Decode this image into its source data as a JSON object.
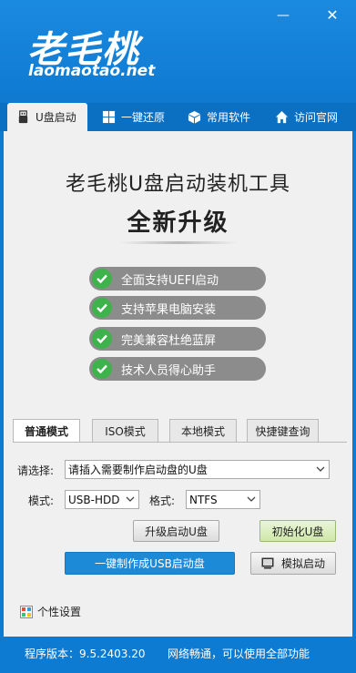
{
  "window": {
    "logo_cn": "老毛桃",
    "logo_en": "laomaotao.net",
    "minimize_glyph": "—",
    "close_glyph": "✕"
  },
  "nav": {
    "items": [
      {
        "label": "U盘启动",
        "icon": "usb-icon",
        "active": true
      },
      {
        "label": "一键还原",
        "icon": "windows-icon",
        "active": false
      },
      {
        "label": "常用软件",
        "icon": "box-icon",
        "active": false
      },
      {
        "label": "访问官网",
        "icon": "home-icon",
        "active": false
      }
    ]
  },
  "hero": {
    "title": "老毛桃U盘启动装机工具",
    "subtitle": "全新升级"
  },
  "features": [
    "全面支持UEFI启动",
    "支持苹果电脑安装",
    "完美兼容杜绝蓝屏",
    "技术人员得心助手"
  ],
  "mode_tabs": [
    "普通模式",
    "ISO模式",
    "本地模式",
    "快捷键查询"
  ],
  "form": {
    "select_label": "请选择:",
    "device_value": "请插入需要制作启动盘的U盘",
    "mode_label": "模式:",
    "mode_value": "USB-HDD",
    "format_label": "格式:",
    "format_value": "NTFS"
  },
  "buttons": {
    "upgrade": "升级启动U盘",
    "init": "初始化U盘",
    "make": "一键制作成USB启动盘",
    "simulate": "模拟启动"
  },
  "personal": "个性设置",
  "footer": {
    "version": "程序版本：9.5.2403.20",
    "network": "网络畅通，可以使用全部功能"
  },
  "colors": {
    "header_blue": "#0f79d0",
    "check_green": "#3fb34b",
    "primary_button": "#1d8ad8"
  }
}
